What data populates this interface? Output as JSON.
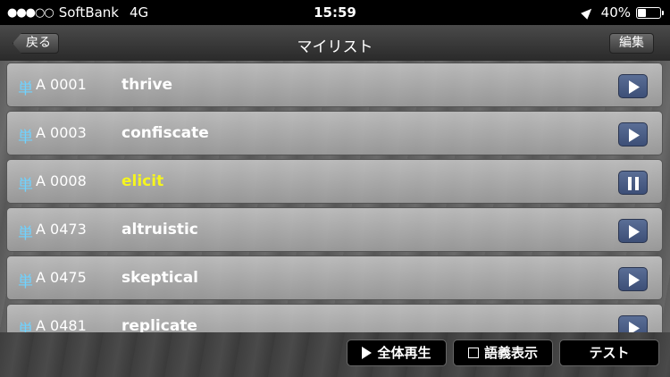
{
  "status": {
    "carrier": "SoftBank",
    "network": "4G",
    "time": "15:59",
    "battery_percent": "40%",
    "battery_level": 0.4,
    "signal_dots": "●●●○○"
  },
  "nav": {
    "back_label": "戻る",
    "title": "マイリスト",
    "edit_label": "編集"
  },
  "rows": [
    {
      "type": "単",
      "code": "A 0001",
      "word": "thrive",
      "playing": false
    },
    {
      "type": "単",
      "code": "A 0003",
      "word": "confiscate",
      "playing": false
    },
    {
      "type": "単",
      "code": "A 0008",
      "word": "elicit",
      "playing": true
    },
    {
      "type": "単",
      "code": "A 0473",
      "word": "altruistic",
      "playing": false
    },
    {
      "type": "単",
      "code": "A 0475",
      "word": "skeptical",
      "playing": false
    },
    {
      "type": "単",
      "code": "A 0481",
      "word": "replicate",
      "playing": false
    }
  ],
  "toolbar": {
    "play_all_label": "全体再生",
    "meaning_label": "語義表示",
    "test_label": "テスト"
  },
  "colors": {
    "active_word": "#f5f51e",
    "type_label": "#6fd2ff",
    "play_button": "#4a5c85"
  }
}
